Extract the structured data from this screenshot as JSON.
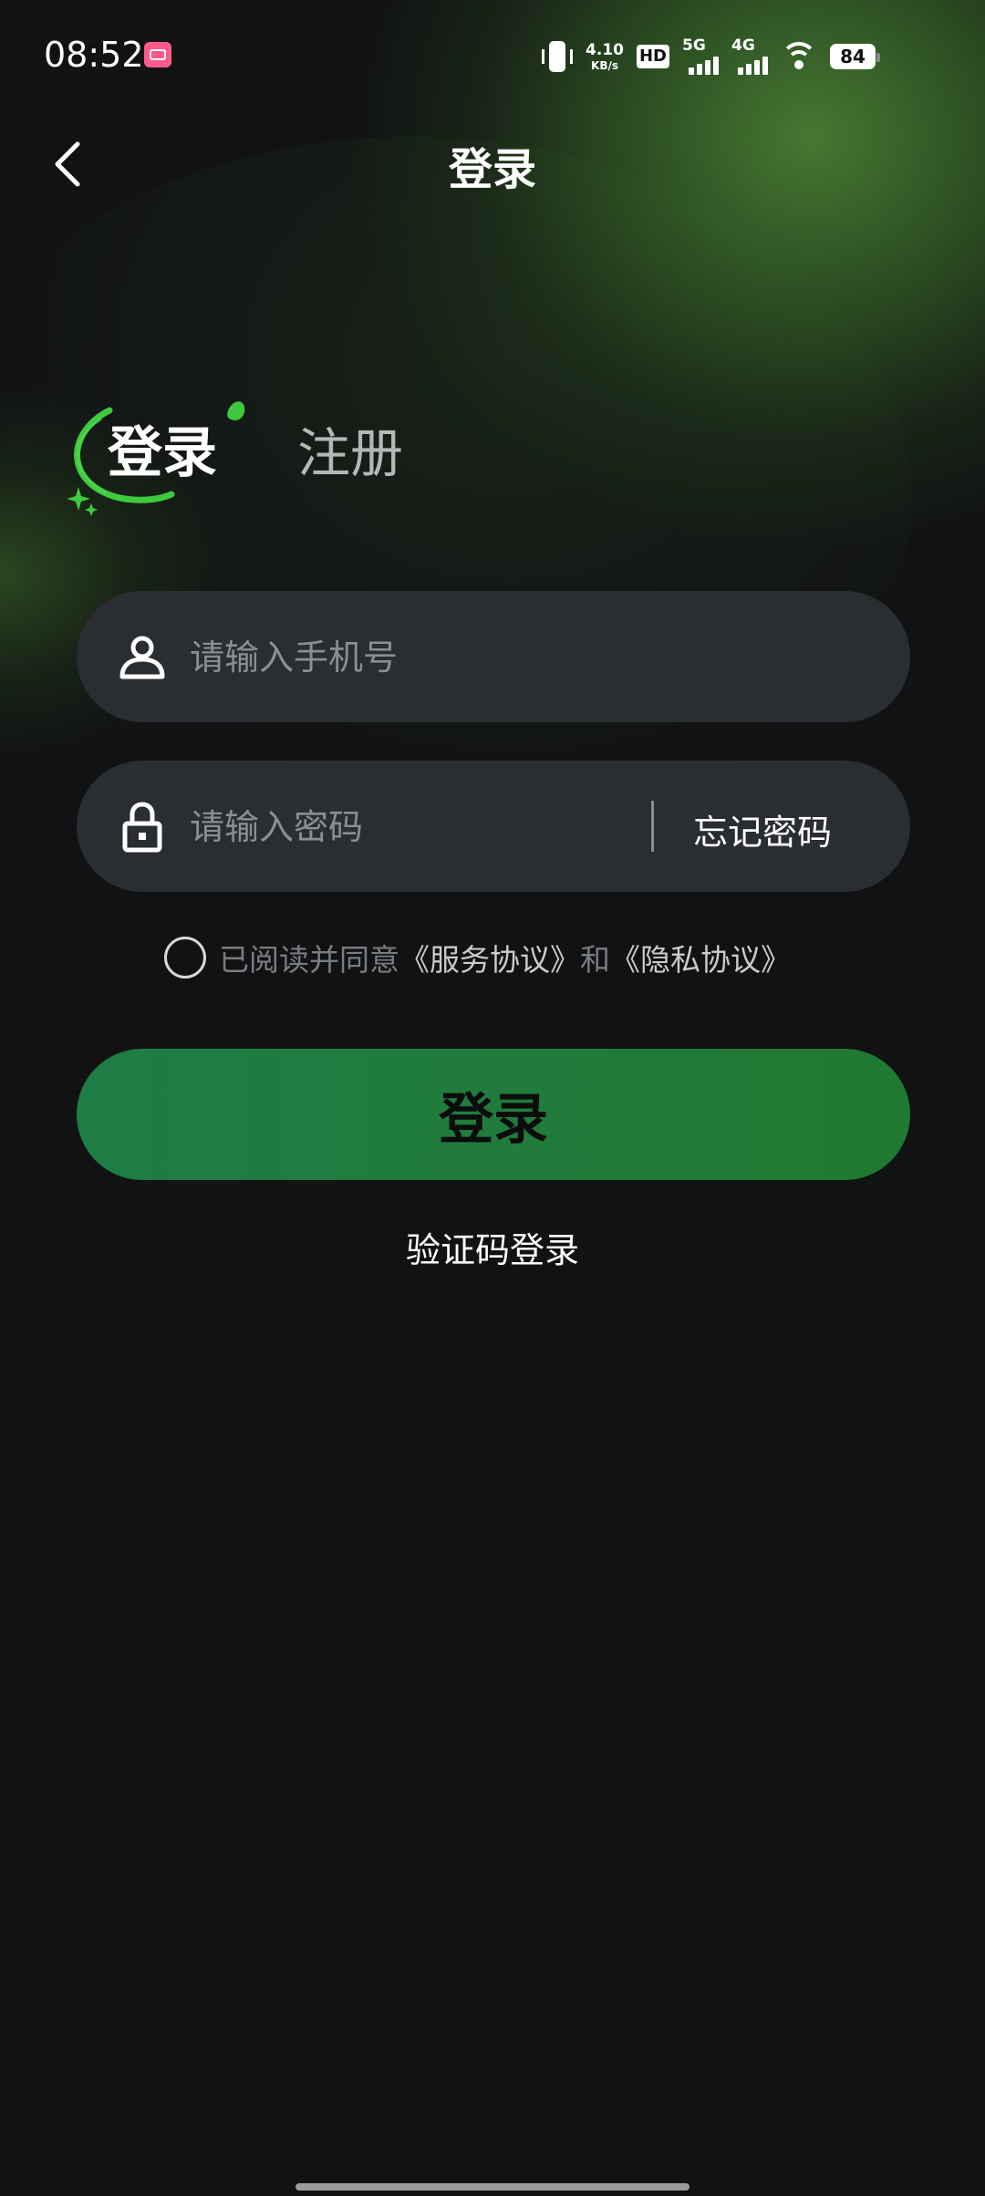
{
  "status_bar": {
    "time": "08:52",
    "net_speed_value": "4.10",
    "net_speed_unit": "KB/s",
    "hd_label": "HD",
    "sim1_label": "5G",
    "sim2_label": "4G",
    "battery": "84"
  },
  "header": {
    "title": "登录"
  },
  "tabs": {
    "login": "登录",
    "register": "注册",
    "active": "login"
  },
  "form": {
    "phone_placeholder": "请输入手机号",
    "phone_value": "",
    "password_placeholder": "请输入密码",
    "password_value": "",
    "forgot_password": "忘记密码"
  },
  "agreement": {
    "checked": false,
    "prefix": "已阅读并同意",
    "service_link": "《服务协议》",
    "and": "和",
    "privacy_link": "《隐私协议》"
  },
  "actions": {
    "login_button": "登录",
    "code_login": "验证码登录"
  },
  "colors": {
    "background": "#111214",
    "accent_green": "#1e7c45",
    "input_bg": "#2a2d31",
    "deco_green": "#3ec93e"
  }
}
